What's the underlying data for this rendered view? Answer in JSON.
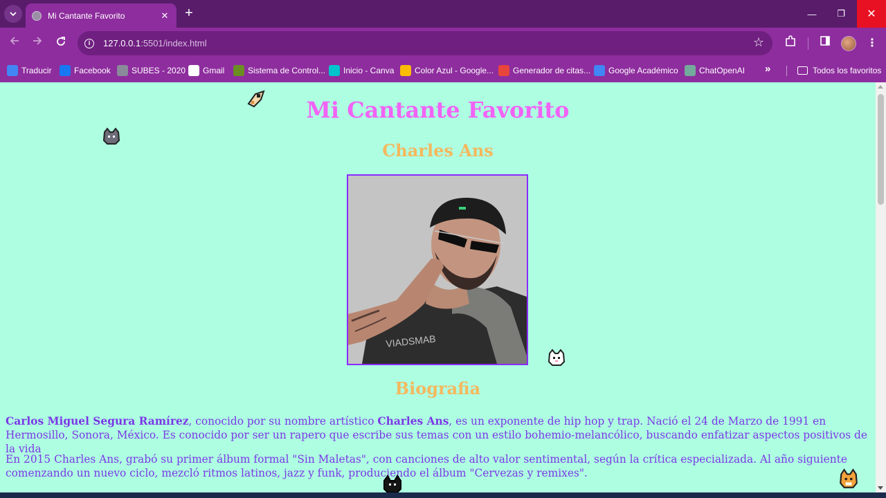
{
  "browser": {
    "tab_title": "Mi Cantante Favorito",
    "tab_close": "✕",
    "new_tab": "+",
    "url_host": "127.0.0.1",
    "url_rest": ":5501/index.html",
    "window_min": "—",
    "window_max": "❐",
    "window_close": "✕"
  },
  "bookmarks": [
    {
      "label": "Traducir",
      "icon": "translate-icon",
      "color": "#4285f4"
    },
    {
      "label": "Facebook",
      "icon": "facebook-icon",
      "color": "#1877f2"
    },
    {
      "label": "SUBES - 2020",
      "icon": "subes-icon",
      "color": "#8a8a9a"
    },
    {
      "label": "Gmail",
      "icon": "google-icon",
      "color": "#ffffff"
    },
    {
      "label": "Sistema de Control...",
      "icon": "sistema-icon",
      "color": "#6b8e23"
    },
    {
      "label": "Inicio - Canva",
      "icon": "canva-icon",
      "color": "#00c4cc"
    },
    {
      "label": "Color Azul - Google...",
      "icon": "drive-icon",
      "color": "#fbbc04"
    },
    {
      "label": "Generador de citas...",
      "icon": "book-icon",
      "color": "#e8453c"
    },
    {
      "label": "Google Académico",
      "icon": "scholar-icon",
      "color": "#4285f4"
    },
    {
      "label": "ChatOpenAI",
      "icon": "chatgpt-icon",
      "color": "#74aa9c"
    }
  ],
  "bookmarks_folder": "Todos los favoritos",
  "page": {
    "title": "Mi Cantante Favorito",
    "subtitle": "Charles Ans",
    "bio_heading": "Biografia",
    "para1_name": "Carlos Miguel Segura Ramírez",
    "para1_mid": ", conocido por su nombre artístico ",
    "para1_art": "Charles Ans",
    "para1_end": ", es un exponente de hip hop y trap. Nació el 24 de Marzo de 1991 en Hermosillo, Sonora, México. Es conocido por ser un rapero que escribe sus temas con un estilo bohemio-melancólico, buscando enfatizar aspectos positivos de la vida",
    "para2": "En 2015 Charles Ans, grabó su primer álbum formal \"Sin Maletas\", con canciones de alto valor sentimental, según la crítica especializada. Al año siguiente comenzando un nuevo ciclo, mezcló ritmos latinos, jazz y funk, produciendo el álbum \"Cervezas y remixes\"."
  },
  "colors": {
    "page_bg": "#aefee2",
    "title": "#f163f5",
    "subtitle": "#f4b85e",
    "text": "#7b38e6",
    "photo_border": "#8a2bff",
    "chrome": "#8e2d9e"
  }
}
